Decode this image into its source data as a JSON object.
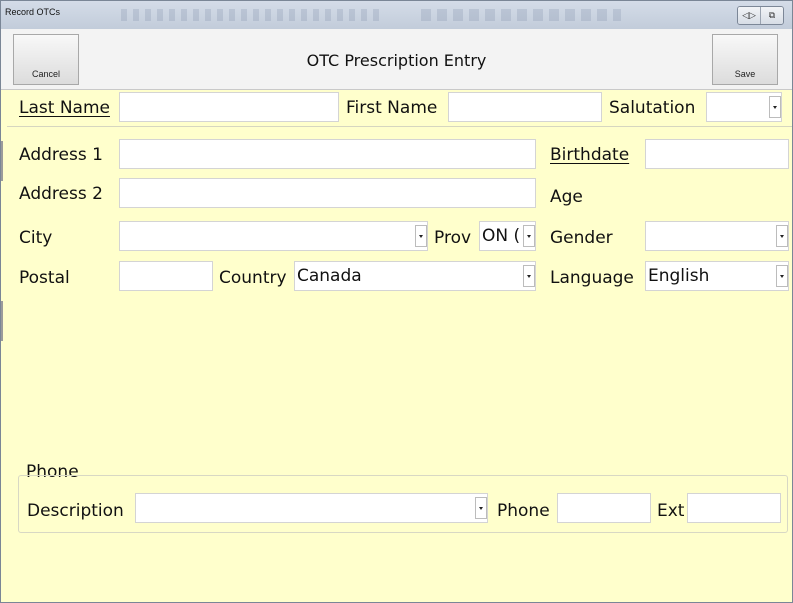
{
  "window": {
    "title": "Record OTCs",
    "controls": [
      "◁▷",
      "⧉"
    ]
  },
  "header": {
    "cancel_label": "Cancel",
    "title": "OTC Prescription Entry",
    "save_label": "Save"
  },
  "name": {
    "last_name_label": "Last Name",
    "last_name_value": "",
    "first_name_label": "First Name",
    "first_name_value": "",
    "salutation_label": "Salutation",
    "salutation_value": ""
  },
  "address": {
    "address1_label": "Address 1",
    "address1_value": "",
    "address2_label": "Address 2",
    "address2_value": "",
    "city_label": "City",
    "city_value": "",
    "prov_label": "Prov",
    "prov_value": "ON (",
    "postal_label": "Postal",
    "postal_value": "",
    "country_label": "Country",
    "country_value": "Canada"
  },
  "personal": {
    "birthdate_label": "Birthdate",
    "birthdate_value": "",
    "age_label": "Age",
    "gender_label": "Gender",
    "gender_value": "",
    "language_label": "Language",
    "language_value": "English"
  },
  "phone": {
    "group_label": "Phone",
    "description_label": "Description",
    "description_value": "",
    "phone_label": "Phone",
    "phone_value": "",
    "ext_label": "Ext",
    "ext_value": ""
  }
}
